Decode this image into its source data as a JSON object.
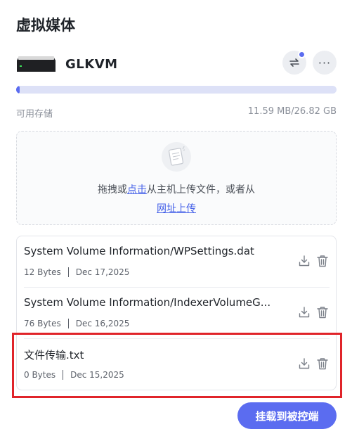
{
  "title": "虚拟媒体",
  "device": {
    "name": "GLKVM"
  },
  "storage": {
    "label": "可用存储",
    "value": "11.59 MB/26.82 GB",
    "used_fraction": 0.004
  },
  "dropzone": {
    "text_before": "拖拽或",
    "click_link": "点击",
    "text_middle": "从主机上传文件，或者从",
    "url_link": "网址上传"
  },
  "files": [
    {
      "name": "System Volume Information/WPSettings.dat",
      "size": "12 Bytes",
      "date": "Dec 17,2025"
    },
    {
      "name": "System Volume Information/IndexerVolumeG...",
      "size": "76 Bytes",
      "date": "Dec 16,2025"
    },
    {
      "name": "文件传输.txt",
      "size": "0 Bytes",
      "date": "Dec 15,2025"
    }
  ],
  "mount_button": "挂载到被控端",
  "colors": {
    "accent": "#5b6cf0",
    "highlight": "#e0242a"
  }
}
